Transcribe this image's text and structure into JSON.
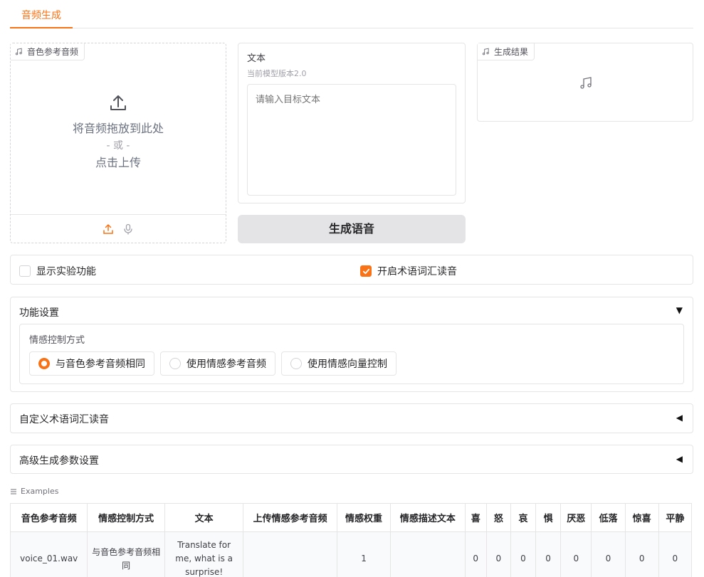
{
  "tab": {
    "label": "音频生成"
  },
  "ref_audio": {
    "label": "音色参考音频",
    "drop_text": "将音频拖放到此处",
    "or_text": "- 或 -",
    "click_text": "点击上传"
  },
  "text_input": {
    "title": "文本",
    "subtitle": "当前模型版本2.0",
    "placeholder": "请输入目标文本"
  },
  "result": {
    "label": "生成结果"
  },
  "generate_button": "生成语音",
  "options": {
    "experimental_label": "显示实验功能",
    "experimental_checked": false,
    "terms_label": "开启术语词汇读音",
    "terms_checked": true
  },
  "feature_settings": {
    "title": "功能设置",
    "arrow": "▼",
    "emotion_label": "情感控制方式",
    "radios": [
      {
        "label": "与音色参考音频相同",
        "selected": true
      },
      {
        "label": "使用情感参考音频",
        "selected": false
      },
      {
        "label": "使用情感向量控制",
        "selected": false
      }
    ]
  },
  "custom_terms": {
    "title": "自定义术语词汇读音",
    "arrow": "◀"
  },
  "advanced": {
    "title": "高级生成参数设置",
    "arrow": "◀"
  },
  "examples": {
    "label": "Examples",
    "headers": [
      "音色参考音频",
      "情感控制方式",
      "文本",
      "上传情感参考音频",
      "情感权重",
      "情感描述文本",
      "喜",
      "怒",
      "哀",
      "惧",
      "厌恶",
      "低落",
      "惊喜",
      "平静"
    ],
    "rows": [
      [
        "voice_01.wav",
        "与音色参考音频相同",
        "Translate for me, what is a surprise!",
        "",
        "1",
        "",
        "0",
        "0",
        "0",
        "0",
        "0",
        "0",
        "0",
        "0"
      ]
    ]
  },
  "colors": {
    "accent": "#f97316",
    "border": "#e5e5e5",
    "muted": "#a1a1aa"
  }
}
